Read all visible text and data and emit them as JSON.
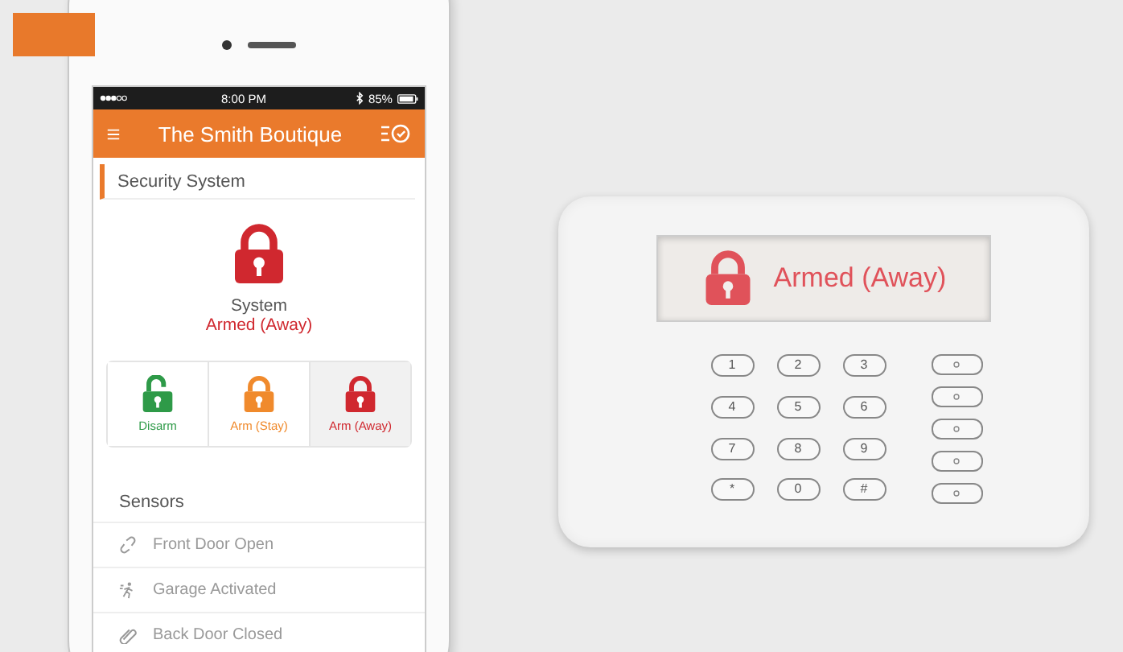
{
  "phone": {
    "status_bar": {
      "time": "8:00 PM",
      "battery": "85%"
    },
    "header": {
      "title": "The Smith Boutique"
    },
    "section": {
      "title": "Security System"
    },
    "system": {
      "label": "System",
      "status": "Armed (Away)"
    },
    "modes": [
      {
        "kind": "disarm",
        "label": "Disarm",
        "color": "#2e9a48",
        "selected": false
      },
      {
        "kind": "stay",
        "label": "Arm (Stay)",
        "color": "#f08a2c",
        "selected": false
      },
      {
        "kind": "away",
        "label": "Arm (Away)",
        "color": "#d0282f",
        "selected": true
      }
    ],
    "sensors": {
      "title": "Sensors",
      "items": [
        {
          "kind": "link",
          "label": "Front Door Open"
        },
        {
          "kind": "motion",
          "label": "Garage Activated"
        },
        {
          "kind": "clip",
          "label": "Back Door Closed"
        }
      ]
    }
  },
  "keypad": {
    "display": "Armed (Away)",
    "keys": [
      "1",
      "2",
      "3",
      "4",
      "5",
      "6",
      "7",
      "8",
      "9",
      "*",
      "0",
      "#"
    ]
  }
}
